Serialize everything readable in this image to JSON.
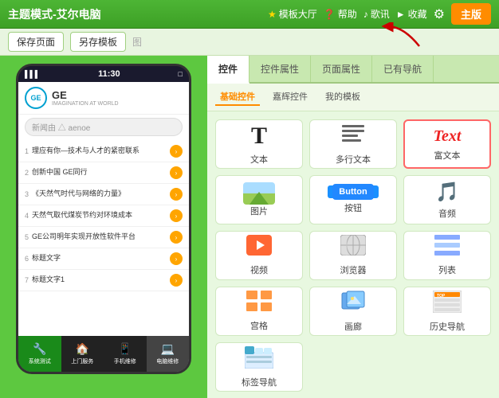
{
  "topNav": {
    "title": "主题模式-艾尔电脑",
    "items": [
      {
        "label": "模板大厅",
        "icon": "★"
      },
      {
        "label": "帮助",
        "icon": "❓"
      },
      {
        "label": "歌讯",
        "icon": "♪"
      },
      {
        "label": "收藏",
        "icon": "►"
      }
    ],
    "gearIcon": "⚙",
    "activeButton": "主版"
  },
  "toolbar": {
    "savePageBtn": "保存页面",
    "saveTemplateBtn": "另存模板",
    "sep": "图"
  },
  "phone": {
    "statusBar": {
      "signal": "▌▌▌",
      "time": "11:30",
      "battery": "□"
    },
    "header": {
      "logoText": "GE",
      "brandName": "GE",
      "tagline": "IMAGINATION AT WORLD"
    },
    "searchPlaceholder": "新闻由 △ aenoe",
    "newsList": [
      {
        "num": "1",
        "text": "理应有你—技术与人才的紧密联系"
      },
      {
        "num": "2",
        "text": "创新中国 GE同行"
      },
      {
        "num": "3",
        "text": "《天然气时代与网络的力量》"
      },
      {
        "num": "4",
        "text": "天然气取代煤炭节约对环境成本"
      },
      {
        "num": "5",
        "text": "GE公司明年实现开放性软件平台"
      },
      {
        "num": "6",
        "text": "标题文字"
      },
      {
        "num": "7",
        "text": "标题文字1"
      }
    ],
    "bottomTabs": [
      {
        "label": "系统测试",
        "icon": "🔧"
      },
      {
        "label": "上门服务",
        "icon": "🏠"
      },
      {
        "label": "手机维修",
        "icon": "📱"
      },
      {
        "label": "电脑维修",
        "icon": "💻"
      }
    ]
  },
  "rightPanel": {
    "tabs": [
      {
        "label": "控件",
        "active": true
      },
      {
        "label": "控件属性"
      },
      {
        "label": "页面属性"
      },
      {
        "label": "已有导航"
      }
    ],
    "subTabs": [
      {
        "label": "基础控件",
        "active": true
      },
      {
        "label": "嘉辉控件"
      },
      {
        "label": "我的模板"
      }
    ],
    "controls": [
      {
        "id": "text",
        "icon": "T",
        "label": "文本",
        "type": "text"
      },
      {
        "id": "multitext",
        "icon": "≡T",
        "label": "多行文本",
        "type": "multitext"
      },
      {
        "id": "richtext",
        "icon": "Text",
        "label": "富文本",
        "type": "richtext"
      },
      {
        "id": "image",
        "icon": "image",
        "label": "图片",
        "type": "image"
      },
      {
        "id": "button",
        "icon": "Button",
        "label": "按钮",
        "type": "button"
      },
      {
        "id": "audio",
        "icon": "♫",
        "label": "音频",
        "type": "audio"
      },
      {
        "id": "video",
        "icon": "▶",
        "label": "视频",
        "type": "video"
      },
      {
        "id": "browser",
        "icon": "⊘",
        "label": "浏览器",
        "type": "browser"
      },
      {
        "id": "list",
        "icon": "☰",
        "label": "列表",
        "type": "list"
      },
      {
        "id": "grid",
        "icon": "⊞",
        "label": "宫格",
        "type": "grid"
      },
      {
        "id": "album",
        "icon": "🖼",
        "label": "画廊",
        "type": "album"
      },
      {
        "id": "history",
        "icon": "TOP",
        "label": "历史导航",
        "type": "history"
      },
      {
        "id": "tabnav",
        "icon": "⊟",
        "label": "标签导航",
        "type": "tabnav"
      }
    ]
  },
  "arrow": {
    "color": "#cc0000"
  }
}
